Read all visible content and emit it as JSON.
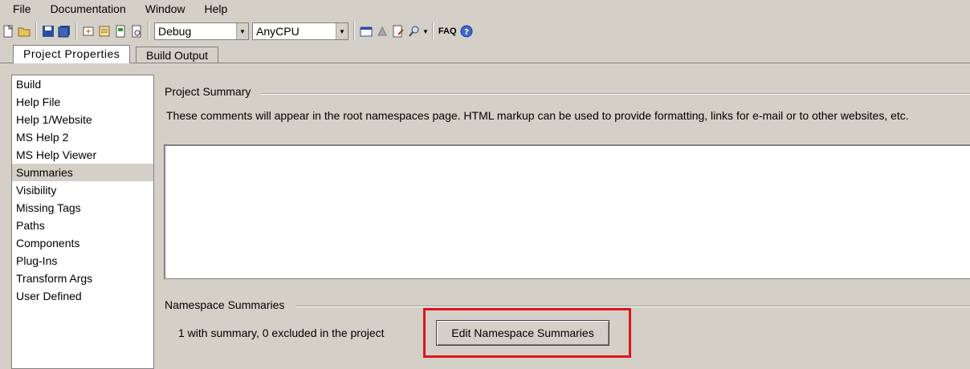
{
  "menu": [
    "File",
    "Documentation",
    "Window",
    "Help"
  ],
  "toolbar": {
    "config": "Debug",
    "platform": "AnyCPU",
    "faq": "FAQ"
  },
  "tabs": [
    "Project Properties",
    "Build Output"
  ],
  "nav": {
    "items": [
      "Build",
      "Help File",
      "Help 1/Website",
      "MS Help 2",
      "MS Help Viewer",
      "Summaries",
      "Visibility",
      "Missing Tags",
      "Paths",
      "Components",
      "Plug-Ins",
      "Transform Args",
      "User Defined"
    ],
    "selected": "Summaries"
  },
  "summary": {
    "group_title": "Project Summary",
    "description": "These comments will appear in the root namespaces page.  HTML markup can be used to provide formatting, links for e-mail or to other websites, etc.",
    "text": ""
  },
  "namespace": {
    "group_title": "Namespace Summaries",
    "count_text": "1 with summary, 0 excluded in the project",
    "button_label": "Edit Namespace Summaries"
  },
  "colors": {
    "highlight": "#e0141e",
    "window": "#d4d0c8"
  }
}
